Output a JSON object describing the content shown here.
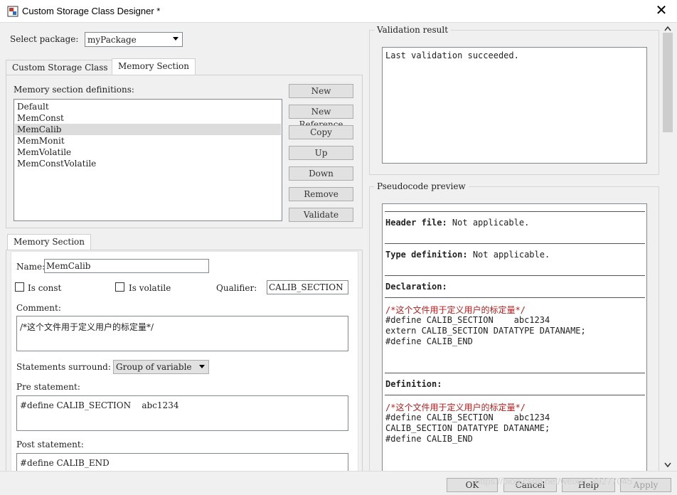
{
  "window": {
    "title": "Custom Storage Class Designer *",
    "close": "✕"
  },
  "package": {
    "label": "Select package:",
    "value": "myPackage"
  },
  "tabs": [
    {
      "label": "Custom Storage Class",
      "active": false
    },
    {
      "label": "Memory Section",
      "active": true
    }
  ],
  "definitions": {
    "label": "Memory section definitions:",
    "items": [
      "Default",
      "MemConst",
      "MemCalib",
      "MemMonit",
      "MemVolatile",
      "MemConstVolatile"
    ],
    "selected": "MemCalib"
  },
  "buttons": {
    "new": "New",
    "new_reference": "New Reference",
    "copy": "Copy",
    "up": "Up",
    "down": "Down",
    "remove": "Remove",
    "validate": "Validate"
  },
  "memory_section": {
    "tab_label": "Memory Section",
    "name_label": "Name:",
    "name_value": "MemCalib",
    "is_const_label": "Is const",
    "is_volatile_label": "Is volatile",
    "qualifier_label": "Qualifier:",
    "qualifier_value": "CALIB_SECTION",
    "comment_label": "Comment:",
    "comment_value": "/*这个文件用于定义用户的标定量*/",
    "statements_label": "Statements surround:",
    "statements_value": "Group of variable",
    "pre_label": "Pre statement:",
    "pre_value": "#define CALIB_SECTION    abc1234",
    "post_label": "Post statement:",
    "post_value": "#define CALIB_END"
  },
  "validation": {
    "label": "Validation result",
    "text": "Last validation succeeded."
  },
  "pseudocode": {
    "label": "Pseudocode preview",
    "header_label": "Header file:",
    "header_value": " Not applicable.",
    "typedef_label": "Type definition:",
    "typedef_value": " Not applicable.",
    "declaration_label": "Declaration:",
    "declaration_lines": [
      "/*这个文件用于定义用户的标定量*/",
      "#define CALIB_SECTION    abc1234",
      "extern CALIB_SECTION DATATYPE DATANAME;",
      "#define CALIB_END"
    ],
    "definition_label": "Definition:",
    "definition_lines": [
      "/*这个文件用于定义用户的标定量*/",
      "#define CALIB_SECTION    abc1234",
      "CALIB_SECTION DATATYPE DATANAME;",
      "#define CALIB_END"
    ]
  },
  "footer": {
    "ok": "OK",
    "cancel": "Cancel",
    "help": "Help",
    "apply": "Apply",
    "watermark": "https://blog.csdn.net/weixin_39277045"
  },
  "colors": {
    "comment_red": "#b02020",
    "selection": "#dcdcdc"
  }
}
